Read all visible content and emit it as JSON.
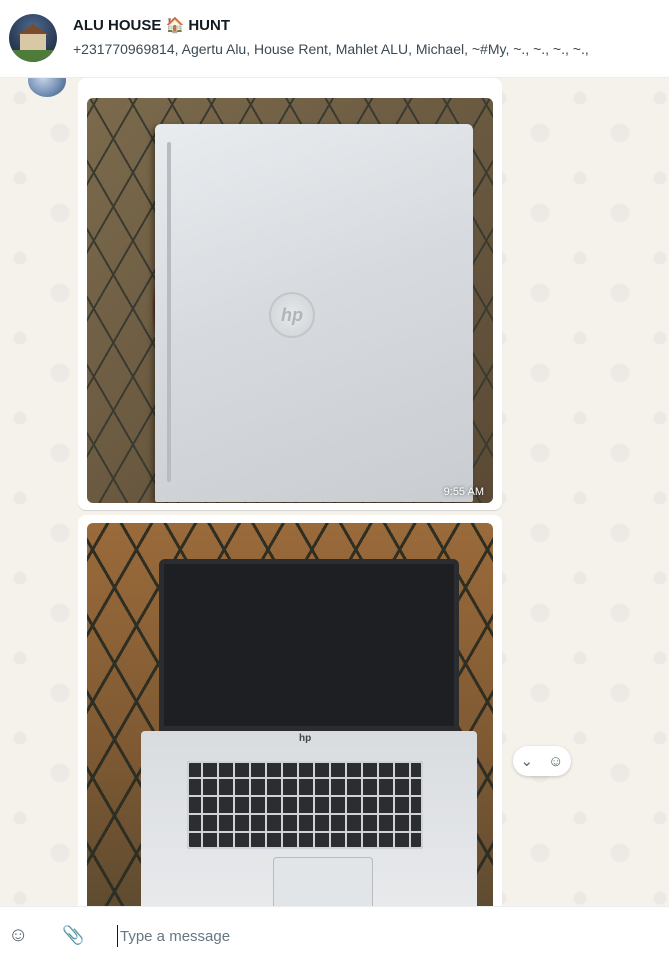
{
  "header": {
    "title": "ALU HOUSE 🏠 HUNT",
    "members": "+231770969814, Agertu Alu, House Rent, Mahlet ALU, Michael, ~#My, ~., ~., ~., ~.,"
  },
  "messages": [
    {
      "type": "image",
      "description_icon": "laptop-closed-photo",
      "time": "9:55 AM"
    },
    {
      "type": "image",
      "description_icon": "laptop-open-photo",
      "time": ""
    }
  ],
  "reaction_bar": {
    "chevron": "⌄",
    "emoji": "☺"
  },
  "composer": {
    "emoji_icon": "☺",
    "attach_icon": "📎",
    "placeholder": "Type a message"
  },
  "colors": {
    "accent": "#53bdeb",
    "background": "#efeae2",
    "bubble": "#ffffff"
  }
}
